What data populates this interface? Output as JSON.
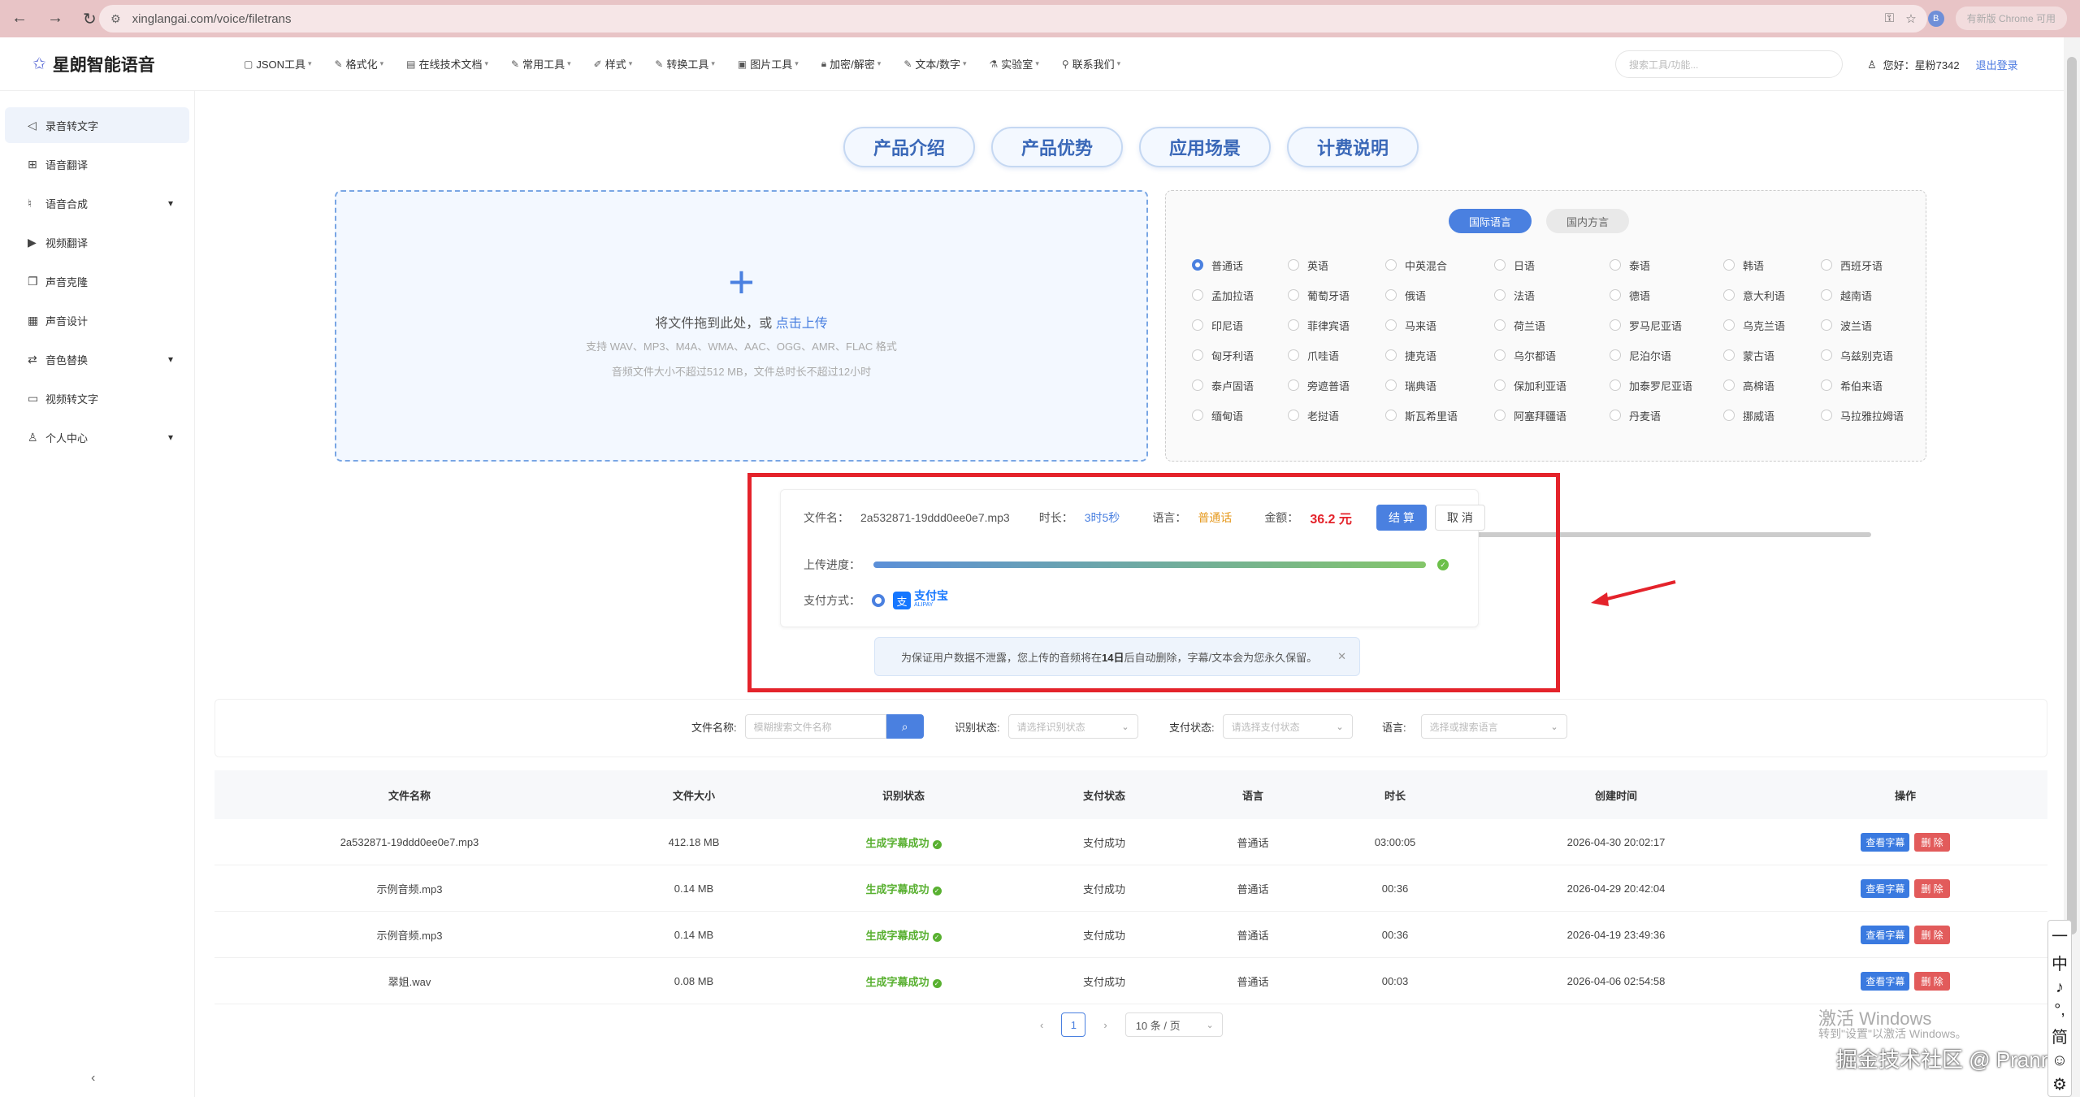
{
  "browser": {
    "url": "xinglangai.com/voice/filetrans",
    "update_label": "有新版 Chrome 可用",
    "profile_initial": "B"
  },
  "header": {
    "logo_text": "星朗智能语音",
    "menu": [
      "JSON工具",
      "格式化",
      "在线技术文档",
      "常用工具",
      "样式",
      "转换工具",
      "图片工具",
      "加密/解密",
      "文本/数字",
      "实验室",
      "联系我们"
    ],
    "search_placeholder": "搜索工具/功能...",
    "greeting": "您好：星粉7342",
    "logout": "退出登录"
  },
  "sidebar": {
    "items": [
      "录音转文字",
      "语音翻译",
      "语音合成",
      "视频翻译",
      "声音克隆",
      "声音设计",
      "音色替换",
      "视频转文字",
      "个人中心"
    ]
  },
  "tabs": [
    "产品介绍",
    "产品优势",
    "应用场景",
    "计费说明"
  ],
  "upload": {
    "main_text": "将文件拖到此处，或",
    "link_text": "点击上传",
    "formats": "支持 WAV、MP3、M4A、WMA、AAC、OGG、AMR、FLAC 格式",
    "limits": "音频文件大小不超过512 MB，文件总时长不超过12小时"
  },
  "language_panel": {
    "tabs": [
      "国际语言",
      "国内方言"
    ],
    "selected": "普通话",
    "languages": [
      "普通话",
      "英语",
      "中英混合",
      "日语",
      "泰语",
      "韩语",
      "西班牙语",
      "孟加拉语",
      "葡萄牙语",
      "俄语",
      "法语",
      "德语",
      "意大利语",
      "越南语",
      "印尼语",
      "菲律宾语",
      "马来语",
      "荷兰语",
      "罗马尼亚语",
      "乌克兰语",
      "波兰语",
      "匈牙利语",
      "爪哇语",
      "捷克语",
      "乌尔都语",
      "尼泊尔语",
      "蒙古语",
      "乌兹别克语",
      "泰卢固语",
      "旁遮普语",
      "瑞典语",
      "保加利亚语",
      "加泰罗尼亚语",
      "高棉语",
      "希伯来语",
      "缅甸语",
      "老挝语",
      "斯瓦希里语",
      "阿塞拜疆语",
      "丹麦语",
      "挪威语",
      "马拉雅拉姆语"
    ]
  },
  "payment": {
    "file_label": "文件名：",
    "file_name": "2a532871-19ddd0ee0e7.mp3",
    "duration_label": "时长：",
    "duration": "3时5秒",
    "language_label": "语言：",
    "language": "普通话",
    "amount_label": "金额：",
    "amount": "36.2 元",
    "pay_button": "结 算",
    "cancel_button": "取 消",
    "progress_label": "上传进度：",
    "progress": 1.0,
    "method_label": "支付方式：",
    "alipay_cn": "支付宝",
    "alipay_en": "ALIPAY"
  },
  "notice": {
    "prefix": "为保证用户数据不泄露，您上传的音频将在",
    "days": "14日",
    "suffix": "后自动删除，字幕/文本会为您永久保留。"
  },
  "filter": {
    "file_name_label": "文件名称:",
    "file_name_placeholder": "模糊搜索文件名称",
    "recognize_label": "识别状态:",
    "recognize_placeholder": "请选择识别状态",
    "pay_label": "支付状态:",
    "pay_placeholder": "请选择支付状态",
    "lang_label": "语言:",
    "lang_placeholder": "选择或搜索语言"
  },
  "table": {
    "headers": [
      "文件名称",
      "文件大小",
      "识别状态",
      "支付状态",
      "语言",
      "时长",
      "创建时间",
      "操作"
    ],
    "rows": [
      {
        "name": "2a532871-19ddd0ee0e7.mp3",
        "size": "412.18 MB",
        "status": "生成字幕成功",
        "pay": "支付成功",
        "lang": "普通话",
        "dur": "03:00:05",
        "time": "2026-04-30 20:02:17"
      },
      {
        "name": "示例音频.mp3",
        "size": "0.14 MB",
        "status": "生成字幕成功",
        "pay": "支付成功",
        "lang": "普通话",
        "dur": "00:36",
        "time": "2026-04-29 20:42:04"
      },
      {
        "name": "示例音频.mp3",
        "size": "0.14 MB",
        "status": "生成字幕成功",
        "pay": "支付成功",
        "lang": "普通话",
        "dur": "00:36",
        "time": "2026-04-19 23:49:36"
      },
      {
        "name": "翠姐.wav",
        "size": "0.08 MB",
        "status": "生成字幕成功",
        "pay": "支付成功",
        "lang": "普通话",
        "dur": "00:03",
        "time": "2026-04-06 02:54:58"
      }
    ],
    "view_button": "查看字幕",
    "delete_button": "删 除"
  },
  "pager": {
    "page": "1",
    "page_size": "10 条 / 页"
  },
  "overlay": {
    "win_activate": "激活 Windows",
    "win_activate_sub": "转到\"设置\"以激活 Windows。",
    "juejin": "掘金技术社区 @ Prann"
  },
  "ime": [
    "一",
    "中",
    "♪",
    "°,",
    "简",
    "☺",
    "⚙"
  ]
}
